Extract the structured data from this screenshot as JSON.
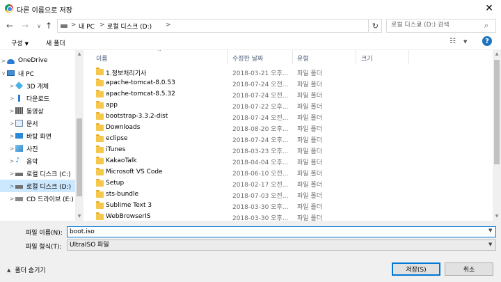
{
  "window": {
    "title": "다른 이름으로 저장",
    "close": "✕"
  },
  "address": {
    "crumbs": [
      "내 PC",
      "로컬 디스크 (D:)"
    ],
    "separators": [
      ">",
      ">",
      ">"
    ],
    "search_placeholder": "로컬 디스크 (D:) 검색"
  },
  "toolbar": {
    "organize": "구성",
    "new_folder": "새 폴더",
    "help": "?"
  },
  "nav": [
    {
      "label": "OneDrive",
      "icon": "cloud-icon",
      "chev": ">",
      "indent": 0
    },
    {
      "label": "내 PC",
      "icon": "pc-icon",
      "chev": "∨",
      "indent": 0
    },
    {
      "label": "3D 개체",
      "icon": "3d-objects-icon",
      "chev": ">",
      "indent": 1
    },
    {
      "label": "다운로드",
      "icon": "download-icon",
      "chev": ">",
      "indent": 1
    },
    {
      "label": "동영상",
      "icon": "video-icon",
      "chev": ">",
      "indent": 1
    },
    {
      "label": "문서",
      "icon": "documents-icon",
      "chev": ">",
      "indent": 1
    },
    {
      "label": "바탕 화면",
      "icon": "desktop-icon",
      "chev": ">",
      "indent": 1
    },
    {
      "label": "사진",
      "icon": "pictures-icon",
      "chev": ">",
      "indent": 1
    },
    {
      "label": "음악",
      "icon": "music-icon",
      "chev": ">",
      "indent": 1
    },
    {
      "label": "로컬 디스크 (C:)",
      "icon": "drive-icon",
      "chev": ">",
      "indent": 1
    },
    {
      "label": "로컬 디스크 (D:)",
      "icon": "drive-icon",
      "chev": ">",
      "indent": 1,
      "selected": true
    },
    {
      "label": "CD 드라이브 (E:)",
      "icon": "cd-drive-icon",
      "chev": ">",
      "indent": 1
    }
  ],
  "columns": {
    "name": "이름",
    "date": "수정한 날짜",
    "type": "유형",
    "size": "크기"
  },
  "files": [
    {
      "name": "1.정보처리기사",
      "date": "2018-03-21 오후...",
      "type": "파일 폴더"
    },
    {
      "name": "apache-tomcat-8.0.53",
      "date": "2018-07-24 오전...",
      "type": "파일 폴더"
    },
    {
      "name": "apache-tomcat-8.5.32",
      "date": "2018-07-24 오전...",
      "type": "파일 폴더"
    },
    {
      "name": "app",
      "date": "2018-07-22 오후...",
      "type": "파일 폴더"
    },
    {
      "name": "bootstrap-3.3.2-dist",
      "date": "2018-07-24 오전...",
      "type": "파일 폴더"
    },
    {
      "name": "Downloads",
      "date": "2018-08-20 오후...",
      "type": "파일 폴더"
    },
    {
      "name": "eclipse",
      "date": "2018-07-24 오후...",
      "type": "파일 폴더"
    },
    {
      "name": "iTunes",
      "date": "2018-03-23 오후...",
      "type": "파일 폴더"
    },
    {
      "name": "KakaoTalk",
      "date": "2018-04-04 오후...",
      "type": "파일 폴더"
    },
    {
      "name": "Microsoft VS Code",
      "date": "2018-06-10 오전...",
      "type": "파일 폴더"
    },
    {
      "name": "Setup",
      "date": "2018-02-17 오전...",
      "type": "파일 폴더"
    },
    {
      "name": "sts-bundle",
      "date": "2018-07-03 오전...",
      "type": "파일 폴더"
    },
    {
      "name": "Sublime Text 3",
      "date": "2018-03-30 오후...",
      "type": "파일 폴더"
    },
    {
      "name": "WebBrowserIS",
      "date": "2018-03-30 오후...",
      "type": "파일 폴더"
    }
  ],
  "bottom": {
    "filename_label": "파일 이름(N):",
    "filename_value": "boot.iso",
    "filetype_label": "파일 형식(T):",
    "filetype_value": "UltraISO 파일",
    "hide_folders": "폴더 숨기기",
    "save": "저장(S)",
    "cancel": "취소"
  }
}
